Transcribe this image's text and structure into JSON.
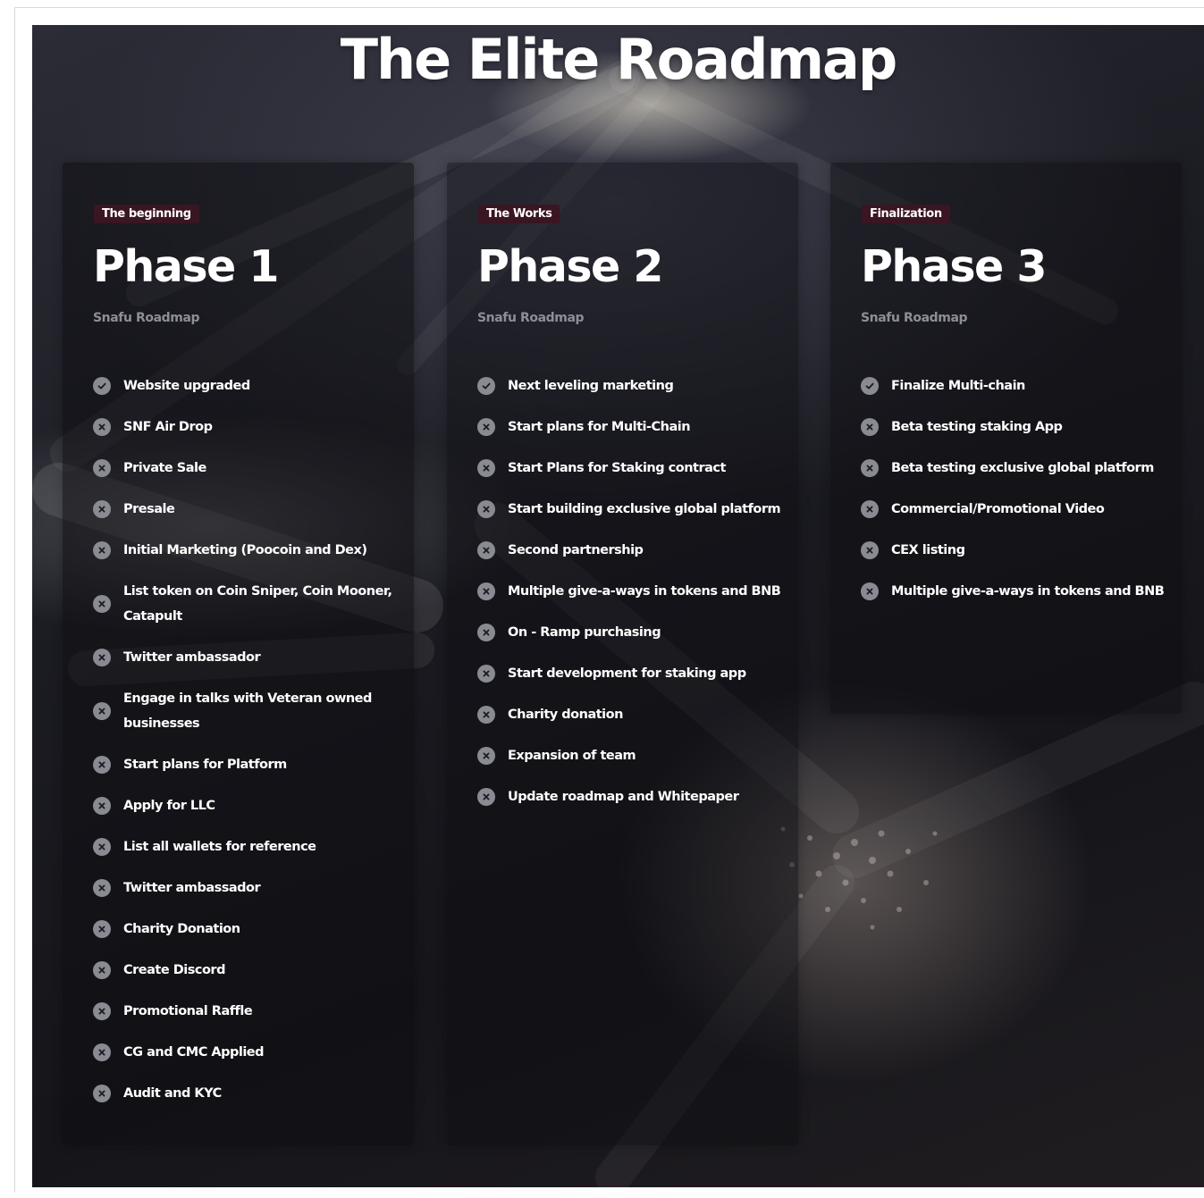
{
  "page": {
    "title": "The Elite Roadmap"
  },
  "phases": [
    {
      "badge": "The beginning",
      "title": "Phase 1",
      "subtitle": "Snafu Roadmap",
      "items": [
        {
          "label": "Website upgraded",
          "status": "done",
          "icon": "check-icon"
        },
        {
          "label": "SNF Air Drop",
          "status": "pending",
          "icon": "x-icon"
        },
        {
          "label": "Private Sale",
          "status": "pending",
          "icon": "x-icon"
        },
        {
          "label": "Presale",
          "status": "pending",
          "icon": "x-icon"
        },
        {
          "label": "Initial Marketing (Poocoin and Dex)",
          "status": "pending",
          "icon": "x-icon"
        },
        {
          "label": "List token on Coin Sniper, Coin Mooner, Catapult",
          "status": "pending",
          "icon": "x-icon"
        },
        {
          "label": "Twitter ambassador",
          "status": "pending",
          "icon": "x-icon"
        },
        {
          "label": "Engage in talks with Veteran owned businesses",
          "status": "pending",
          "icon": "x-icon"
        },
        {
          "label": "Start plans for Platform",
          "status": "pending",
          "icon": "x-icon"
        },
        {
          "label": "Apply for LLC",
          "status": "pending",
          "icon": "x-icon"
        },
        {
          "label": "List all wallets for reference",
          "status": "pending",
          "icon": "x-icon"
        },
        {
          "label": "Twitter ambassador",
          "status": "pending",
          "icon": "x-icon"
        },
        {
          "label": "Charity Donation",
          "status": "pending",
          "icon": "x-icon"
        },
        {
          "label": "Create Discord",
          "status": "pending",
          "icon": "x-icon"
        },
        {
          "label": "Promotional Raffle",
          "status": "pending",
          "icon": "x-icon"
        },
        {
          "label": "CG and CMC Applied",
          "status": "pending",
          "icon": "x-icon"
        },
        {
          "label": "Audit and KYC",
          "status": "pending",
          "icon": "x-icon"
        }
      ]
    },
    {
      "badge": "The Works",
      "title": "Phase 2",
      "subtitle": "Snafu Roadmap",
      "items": [
        {
          "label": "Next leveling marketing",
          "status": "done",
          "icon": "check-icon"
        },
        {
          "label": "Start plans for Multi-Chain",
          "status": "pending",
          "icon": "x-icon"
        },
        {
          "label": "Start Plans for Staking contract",
          "status": "pending",
          "icon": "x-icon"
        },
        {
          "label": "Start building exclusive global platform",
          "status": "pending",
          "icon": "x-icon"
        },
        {
          "label": "Second partnership",
          "status": "pending",
          "icon": "x-icon"
        },
        {
          "label": "Multiple give-a-ways in tokens and BNB",
          "status": "pending",
          "icon": "x-icon"
        },
        {
          "label": "On - Ramp purchasing",
          "status": "pending",
          "icon": "x-icon"
        },
        {
          "label": "Start development for staking app",
          "status": "pending",
          "icon": "x-icon"
        },
        {
          "label": "Charity donation",
          "status": "pending",
          "icon": "x-icon"
        },
        {
          "label": "Expansion of team",
          "status": "pending",
          "icon": "x-icon"
        },
        {
          "label": "Update roadmap and Whitepaper",
          "status": "pending",
          "icon": "x-icon"
        }
      ]
    },
    {
      "badge": "Finalization",
      "title": "Phase 3",
      "subtitle": "Snafu Roadmap",
      "items": [
        {
          "label": "Finalize Multi-chain",
          "status": "done",
          "icon": "check-icon"
        },
        {
          "label": "Beta testing staking App",
          "status": "pending",
          "icon": "x-icon"
        },
        {
          "label": "Beta testing exclusive global platform",
          "status": "pending",
          "icon": "x-icon"
        },
        {
          "label": "Commercial/Promotional Video",
          "status": "pending",
          "icon": "x-icon"
        },
        {
          "label": "CEX listing",
          "status": "pending",
          "icon": "x-icon"
        },
        {
          "label": "Multiple give-a-ways in tokens and BNB",
          "status": "pending",
          "icon": "x-icon"
        }
      ]
    }
  ],
  "colors": {
    "badge_background": "#3a1522",
    "icon_circle": "#8a8a93",
    "subtitle_text": "#8e8e98",
    "text": "#ffffff"
  }
}
